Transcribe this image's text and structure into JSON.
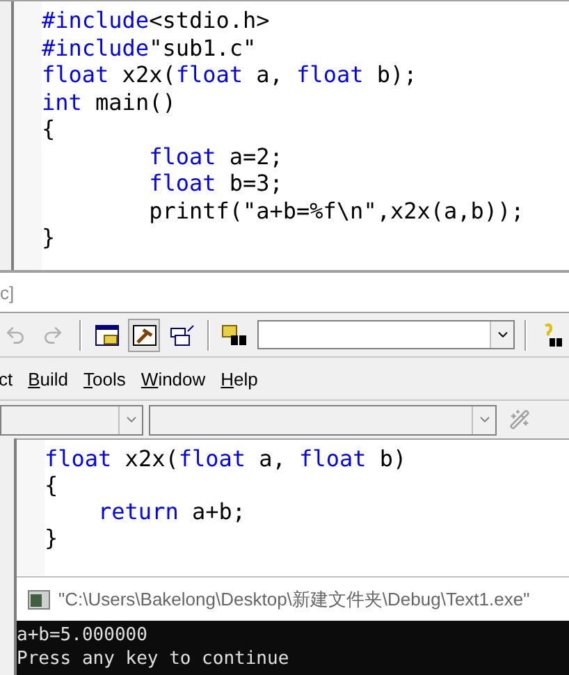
{
  "editor_top": {
    "lines": [
      [
        {
          "text": "#include",
          "kind": "keyword"
        },
        {
          "text": "<stdio.h>",
          "kind": "plain"
        }
      ],
      [
        {
          "text": "#include",
          "kind": "keyword"
        },
        {
          "text": "\"sub1.c\"",
          "kind": "plain"
        }
      ],
      [
        {
          "text": "float",
          "kind": "keyword"
        },
        {
          "text": " x2x(",
          "kind": "plain"
        },
        {
          "text": "float",
          "kind": "keyword"
        },
        {
          "text": " a, ",
          "kind": "plain"
        },
        {
          "text": "float",
          "kind": "keyword"
        },
        {
          "text": " b);",
          "kind": "plain"
        }
      ],
      [
        {
          "text": "int",
          "kind": "keyword"
        },
        {
          "text": " main()",
          "kind": "plain"
        }
      ],
      [
        {
          "text": "{",
          "kind": "plain"
        }
      ],
      [
        {
          "text": "\tfloat",
          "kind": "keyword"
        },
        {
          "text": " a=2;",
          "kind": "plain"
        }
      ],
      [
        {
          "text": "\tfloat",
          "kind": "keyword"
        },
        {
          "text": " b=3;",
          "kind": "plain"
        }
      ],
      [
        {
          "text": "\tprintf(\"a+b=%f\\n\",x2x(a,b));",
          "kind": "plain"
        }
      ],
      [
        {
          "text": "}",
          "kind": "plain"
        }
      ]
    ]
  },
  "window_title_fragment": "c]",
  "menu": [
    {
      "kind": "plain",
      "label": "ct"
    },
    {
      "kind": "mnemonic",
      "key": "B",
      "label": "uild"
    },
    {
      "kind": "mnemonic",
      "key": "T",
      "label": "ools"
    },
    {
      "kind": "mnemonic",
      "key": "W",
      "label": "indow"
    },
    {
      "kind": "mnemonic",
      "key": "H",
      "label": "elp"
    }
  ],
  "editor_bottom": {
    "lines": [
      [
        {
          "text": "float",
          "kind": "keyword"
        },
        {
          "text": " x2x(",
          "kind": "plain"
        },
        {
          "text": "float",
          "kind": "keyword"
        },
        {
          "text": " a, ",
          "kind": "plain"
        },
        {
          "text": "float",
          "kind": "keyword"
        },
        {
          "text": " b)",
          "kind": "plain"
        }
      ],
      [
        {
          "text": "{",
          "kind": "plain"
        }
      ],
      [
        {
          "text": "\treturn",
          "kind": "keyword"
        },
        {
          "text": " a+b;",
          "kind": "plain"
        }
      ],
      [
        {
          "text": "}",
          "kind": "plain"
        }
      ]
    ]
  },
  "console": {
    "title": "\"C:\\Users\\Bakelong\\Desktop\\新建文件夹\\Debug\\Text1.exe\"",
    "lines": [
      "a+b=5.000000",
      "Press any key to continue"
    ]
  }
}
